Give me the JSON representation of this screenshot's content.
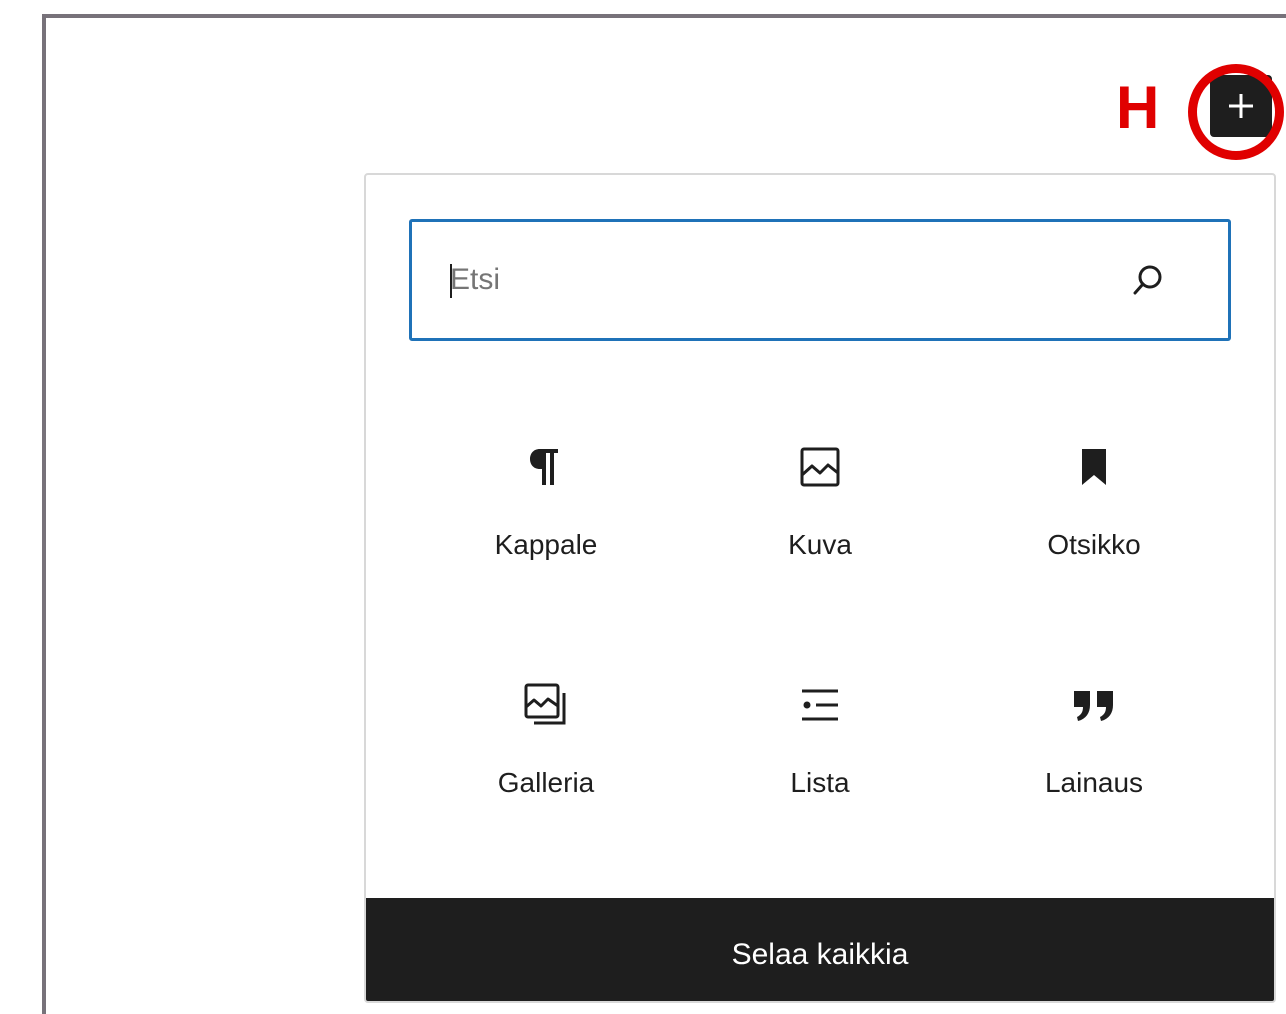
{
  "annotation": {
    "label": "H",
    "color": "#e00000"
  },
  "toolbar": {
    "add_block_icon": "plus-icon"
  },
  "inserter": {
    "search": {
      "placeholder": "Etsi",
      "value": "",
      "icon": "search-icon"
    },
    "blocks": [
      {
        "label": "Kappale",
        "icon": "paragraph-icon"
      },
      {
        "label": "Kuva",
        "icon": "image-icon"
      },
      {
        "label": "Otsikko",
        "icon": "bookmark-icon"
      },
      {
        "label": "Galleria",
        "icon": "gallery-icon"
      },
      {
        "label": "Lista",
        "icon": "list-icon"
      },
      {
        "label": "Lainaus",
        "icon": "quote-icon"
      }
    ],
    "browse_all_label": "Selaa kaikkia"
  },
  "colors": {
    "accent": "#1f72b8",
    "dark": "#1e1e1e",
    "frame": "#77727a"
  }
}
